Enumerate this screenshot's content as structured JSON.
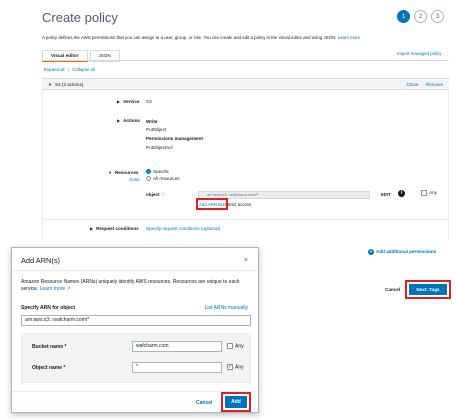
{
  "header": {
    "title": "Create policy",
    "steps": [
      "1",
      "2",
      "3"
    ]
  },
  "intro": {
    "text": "A policy defines the AWS permissions that you can assign to a user, group, or role. You can create and edit a policy in the visual editor and using JSON.",
    "learn_more": "Learn more"
  },
  "tabs": {
    "visual": "Visual editor",
    "json": "JSON",
    "import": "Import managed policy"
  },
  "expand": {
    "expand_all": "Expand all",
    "collapse_all": "Collapse all"
  },
  "section": {
    "title": "S3 (3 actions)",
    "clone": "Clone",
    "remove": "Remove"
  },
  "service": {
    "label": "Service",
    "value": "S3"
  },
  "actions": {
    "label": "Actions",
    "group1": "Write",
    "item1": "PutObject",
    "group2": "Permissions management",
    "item2": "PutObjectAcl"
  },
  "resources": {
    "label": "Resources",
    "close": "close",
    "specific": "Specific",
    "all": "All resources",
    "object_label": "object",
    "arn_value": "arn:aws:s3:::wafcharm.com/*",
    "edit": "EDIT",
    "any": "Any",
    "add_arn": "Add ARN",
    "restrict": "to restrict access"
  },
  "request_conditions": {
    "label": "Request conditions",
    "value": "Specify request conditions (optional)"
  },
  "add_permissions": "Add additional permissions",
  "footer": {
    "cancel": "Cancel",
    "next": "Next: Tags"
  },
  "modal": {
    "title": "Add ARN(s)",
    "close": "×",
    "description": "Amazon Resource Names (ARNs) uniquely identify AWS resources. Resources are unique to each service.",
    "learn_more": "Learn more",
    "specify_label": "Specify ARN for object",
    "list_manually": "List ARNs manually",
    "arn_input": "arn:aws:s3:::wafcharm.com/*",
    "bucket_label": "Bucket name *",
    "bucket_value": "wafcharm.com",
    "bucket_any": "Any",
    "object_label": "Object name *",
    "object_value": "*",
    "object_any": "Any",
    "cancel": "Cancel",
    "add": "Add"
  },
  "colors": {
    "accent": "#0073bb",
    "highlight": "#e02020",
    "tab_active": "#ec7211"
  }
}
